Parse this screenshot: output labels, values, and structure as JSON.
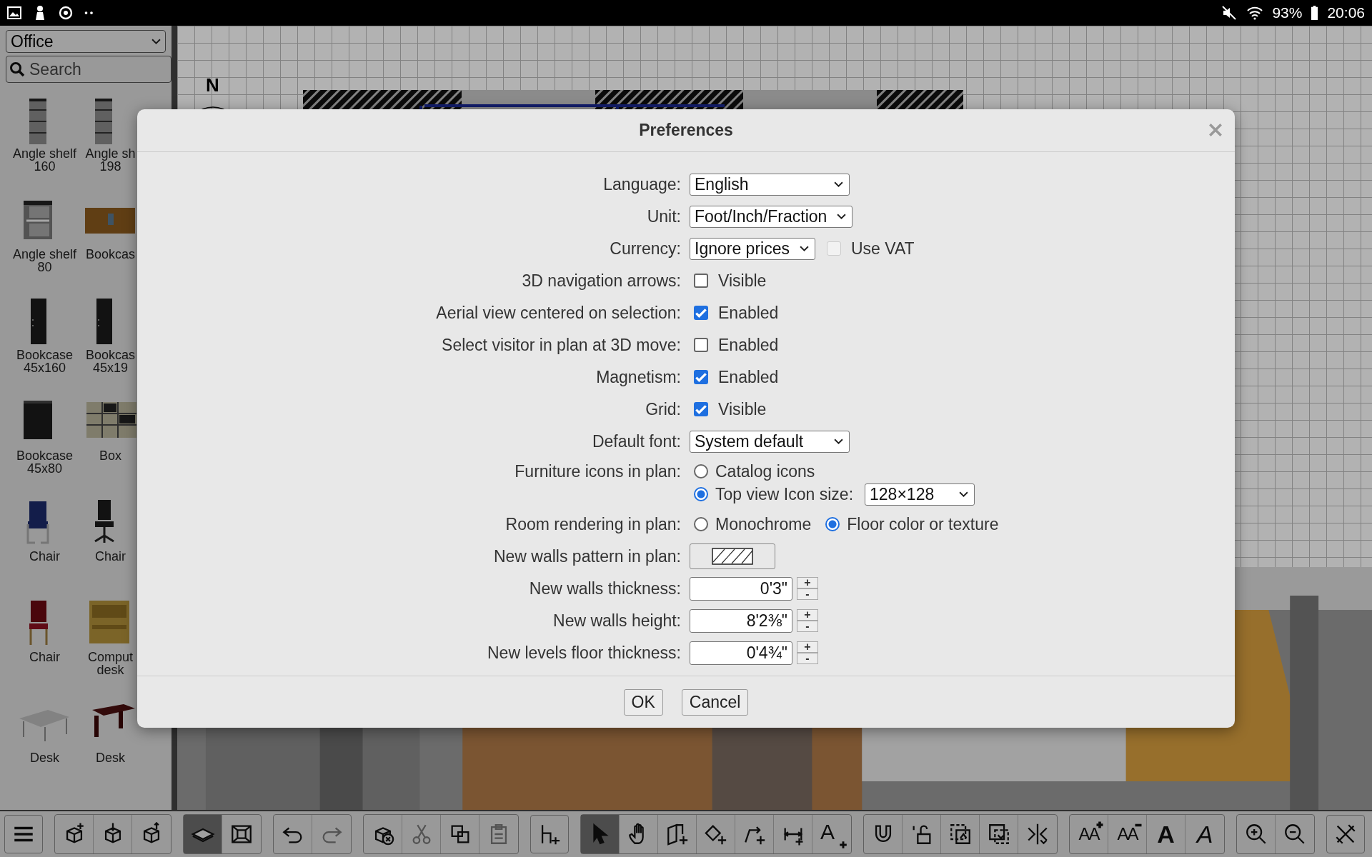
{
  "status_bar": {
    "battery": "93%",
    "time": "20:06"
  },
  "catalog": {
    "category": "Office",
    "search_placeholder": "Search",
    "items": [
      {
        "label": "Angle shelf\n160",
        "kind": "shelf"
      },
      {
        "label": "Angle sh\n198",
        "kind": "shelf"
      },
      {
        "label": "Angle shelf\n80",
        "kind": "corner_shelf"
      },
      {
        "label": "Bookcas",
        "kind": "low_bookcase"
      },
      {
        "label": "Bookcase\n45x160",
        "kind": "tall_bookcase"
      },
      {
        "label": "Bookcas\n45x19",
        "kind": "tall_bookcase"
      },
      {
        "label": "Bookcase\n45x80",
        "kind": "cabinet"
      },
      {
        "label": "Box",
        "kind": "lockers"
      },
      {
        "label": "Chair",
        "kind": "armchair"
      },
      {
        "label": "Chair",
        "kind": "office_chair"
      },
      {
        "label": "Chair",
        "kind": "wood_chair"
      },
      {
        "label": "Comput\ndesk",
        "kind": "computer_desk"
      },
      {
        "label": "Desk",
        "kind": "desk"
      },
      {
        "label": "Desk",
        "kind": "corner_desk"
      }
    ]
  },
  "plan": {
    "compass_label": "N"
  },
  "dialog": {
    "title": "Preferences",
    "rows": [
      {
        "label": "Language:",
        "kind": "select",
        "value": "English"
      },
      {
        "label": "Unit:",
        "kind": "select",
        "value": "Foot/Inch/Fraction"
      },
      {
        "label": "Currency:",
        "kind": "select_check",
        "value": "Ignore prices",
        "check_label": "Use VAT",
        "checked": false,
        "disabled": true
      },
      {
        "label": "3D navigation arrows:",
        "kind": "checkbox",
        "text": "Visible",
        "checked": false
      },
      {
        "label": "Aerial view centered on selection:",
        "kind": "checkbox",
        "text": "Enabled",
        "checked": true
      },
      {
        "label": "Select visitor in plan at 3D move:",
        "kind": "checkbox",
        "text": "Enabled",
        "checked": false
      },
      {
        "label": "Magnetism:",
        "kind": "checkbox",
        "text": "Enabled",
        "checked": true
      },
      {
        "label": "Grid:",
        "kind": "checkbox",
        "text": "Visible",
        "checked": true
      },
      {
        "label": "Default font:",
        "kind": "select",
        "value": "System default"
      },
      {
        "label": "Furniture icons in plan:",
        "kind": "radio_stack",
        "options": [
          {
            "label": "Catalog icons",
            "selected": false
          },
          {
            "label": "Top view Icon size:",
            "selected": true,
            "select": "128×128"
          }
        ]
      },
      {
        "label": "Room rendering in plan:",
        "kind": "radio_row",
        "options": [
          {
            "label": "Monochrome",
            "selected": false
          },
          {
            "label": "Floor color or texture",
            "selected": true
          }
        ]
      },
      {
        "label": "New walls pattern in plan:",
        "kind": "pattern"
      },
      {
        "label": "New walls thickness:",
        "kind": "spinner",
        "value": "0'3\"",
        "up": "+",
        "down": "-"
      },
      {
        "label": "New walls height:",
        "kind": "spinner",
        "value": "8'2⅜\"",
        "up": "+",
        "down": "-"
      },
      {
        "label": "New levels floor thickness:",
        "kind": "spinner",
        "value": "0'4¾\"",
        "up": "+",
        "down": "-"
      }
    ],
    "buttons": [
      "OK",
      "Cancel"
    ]
  },
  "toolbar": [
    {
      "buttons": [
        {
          "selected": false
        }
      ]
    },
    {
      "buttons": [
        {
          "selected": false
        },
        {
          "selected": false
        },
        {
          "selected": false
        }
      ]
    },
    {
      "buttons": [
        {
          "selected": true
        },
        {
          "selected": false
        }
      ]
    },
    {
      "buttons": [
        {
          "selected": false
        },
        {
          "selected": false
        }
      ]
    },
    {
      "buttons": [
        {
          "selected": false
        },
        {
          "selected": false
        },
        {
          "selected": false
        },
        {
          "selected": false
        }
      ]
    },
    {
      "buttons": [
        {
          "selected": false
        }
      ]
    },
    {
      "buttons": [
        {
          "selected": true
        },
        {
          "selected": false
        },
        {
          "selected": false
        },
        {
          "selected": false
        },
        {
          "selected": false
        },
        {
          "selected": false
        },
        {
          "selected": false,
          "glyph": "A"
        }
      ]
    },
    {
      "buttons": [
        {
          "selected": false
        },
        {
          "selected": false
        },
        {
          "selected": false
        },
        {
          "selected": false
        },
        {
          "selected": false
        }
      ]
    },
    {
      "buttons": [
        {
          "selected": false,
          "glyph": "AA"
        },
        {
          "selected": false,
          "glyph": "AA"
        },
        {
          "selected": false,
          "glyph": "A"
        },
        {
          "selected": false,
          "glyph": "A"
        }
      ]
    },
    {
      "buttons": [
        {
          "selected": false
        },
        {
          "selected": false
        }
      ]
    },
    {
      "buttons": [
        {
          "selected": false
        }
      ]
    }
  ]
}
